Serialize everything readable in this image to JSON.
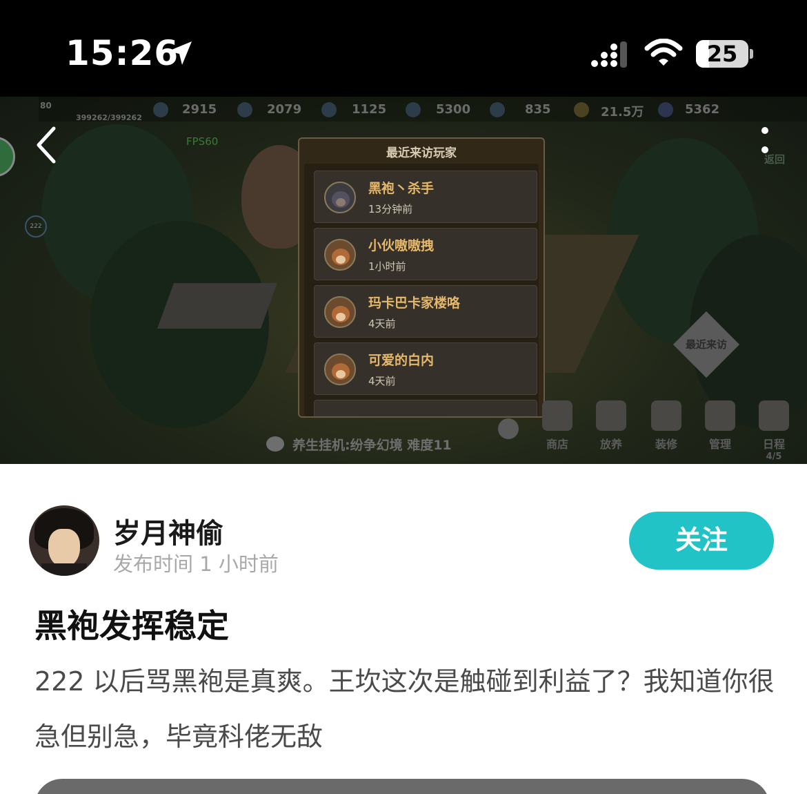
{
  "status_bar": {
    "time": "15:26",
    "battery": "25",
    "battery_level": 0.25,
    "icons": [
      "location-arrow-icon",
      "signal-icon",
      "wifi-icon",
      "battery-icon"
    ]
  },
  "game": {
    "level": "80",
    "hp": "399262/399262",
    "fps": "FPS60",
    "resources": [
      "2915",
      "2079",
      "1125",
      "5300",
      "835",
      "21.5万",
      "5362"
    ],
    "dialog": {
      "title": "最近来访玩家",
      "visitors": [
        {
          "name": "黑袍丶杀手",
          "time": "13分钟前"
        },
        {
          "name": "小伙嗷嗷拽",
          "time": "1小时前"
        },
        {
          "name": "玛卡巴卡家楼咯",
          "time": "4天前"
        },
        {
          "name": "可爱的白内",
          "time": "4天前"
        }
      ]
    },
    "recent_visit_label": "最近来访",
    "back_label": "返回",
    "idle_status": "养生挂机:纷争幻境 难度11",
    "circle_badge": "222",
    "menu": [
      {
        "label": "商店"
      },
      {
        "label": "放养"
      },
      {
        "label": "装修"
      },
      {
        "label": "管理"
      },
      {
        "label": "日程"
      }
    ],
    "schedule_count": "4/5"
  },
  "post": {
    "author": "岁月神偷",
    "publish_time": "发布时间 1 小时前",
    "follow_label": "关注",
    "title": "黑袍发挥稳定",
    "body": "222 以后骂黑袍是真爽。王坎这次是触碰到利益了？我知道你很急但别急，毕竟科佬无敌"
  },
  "colors": {
    "accent": "#22c3c7",
    "status_bar_bg": "#000000",
    "visitor_name": "#e6b86a"
  }
}
